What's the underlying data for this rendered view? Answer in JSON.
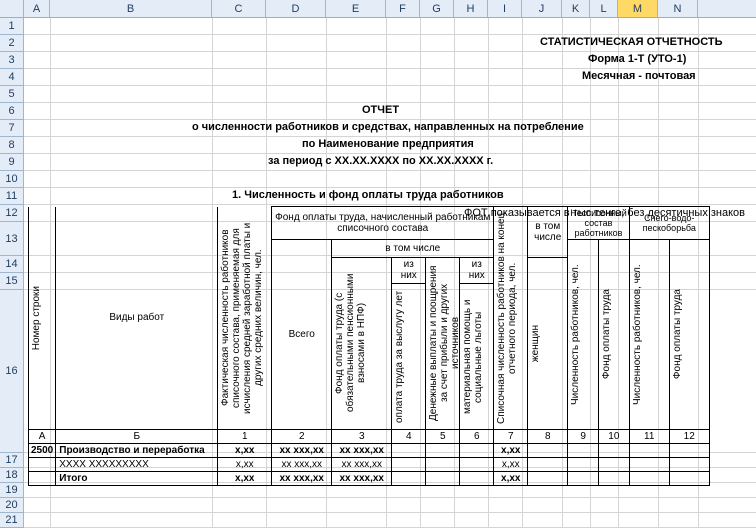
{
  "columns": [
    {
      "label": "A",
      "w": 26
    },
    {
      "label": "B",
      "w": 162
    },
    {
      "label": "C",
      "w": 54
    },
    {
      "label": "D",
      "w": 60
    },
    {
      "label": "E",
      "w": 60
    },
    {
      "label": "F",
      "w": 34
    },
    {
      "label": "G",
      "w": 34
    },
    {
      "label": "H",
      "w": 34
    },
    {
      "label": "I",
      "w": 34
    },
    {
      "label": "J",
      "w": 40
    },
    {
      "label": "K",
      "w": 28
    },
    {
      "label": "L",
      "w": 28
    },
    {
      "label": "M",
      "w": 40
    },
    {
      "label": "N",
      "w": 40
    }
  ],
  "selected_col": "M",
  "row_labels": [
    "1",
    "2",
    "3",
    "4",
    "5",
    "6",
    "7",
    "8",
    "9",
    "10",
    "11",
    "12",
    "13",
    "14",
    "15",
    "16",
    "17",
    "18",
    "19",
    "20",
    "21"
  ],
  "header": {
    "stat": "СТАТИСТИЧЕСКАЯ ОТЧЕТНОСТЬ",
    "form": "Форма 1-Т (УТО-1)",
    "period_type": "Месячная - почтовая",
    "title": "ОТЧЕТ",
    "line1": "о численности работников и средствах, направленных на потребление",
    "line2": "по Наименование предприятия",
    "line3": "за период с XX.XX.XXXX по XX.XX.XXXX г.",
    "section": "1. Численность и фонд оплаты труда работников",
    "footnote": "ФОТ показывается в тыс.тенге, без десятичных знаков"
  },
  "tbl": {
    "h": {
      "row_no": "Номер строки",
      "work_types": "Виды работ",
      "fact_count": "Фактическая численность работников списочного состава, применяемая для исчисления средней заработной платы и других средних величин, чел.",
      "fot_group": "Фонд оплаты труда, начисленный работникам списочного состава",
      "vsego": "Всего",
      "vtomchisle": "в том числе",
      "iznih": "из них",
      "fot_npf": "Фонд оплаты труда (с обязательными пенсионными взносами в НПФ)",
      "vysluga": "оплата труда за выслугу лет",
      "denezh": "Денежные выплаты и поощрения за счет прибыли и других источников",
      "matpom": "материальная помощь и социальные льготы",
      "spis_count": "Списочная численность работников на конец отчетного периода, чел.",
      "vtomchisle2": "в том числе",
      "women": "женщин",
      "nespis": "Несписочный состав работников",
      "snego": "Снего-водо-пескоборьба",
      "chisl": "Численность работников, чел.",
      "fot": "Фонд оплаты труда"
    },
    "numrow": [
      "А",
      "Б",
      "1",
      "2",
      "3",
      "4",
      "5",
      "6",
      "7",
      "8",
      "9",
      "10",
      "11",
      "12"
    ],
    "rows": [
      {
        "n": "2500",
        "name": "Производство и переработка",
        "vals": [
          "x,xx",
          "xx xxx,xx",
          "xx xxx,xx",
          "",
          "",
          "",
          "x,xx",
          "",
          "",
          "",
          "",
          ""
        ]
      },
      {
        "n": "",
        "name": "XXXX XXXXXXXXX",
        "vals": [
          "x,xx",
          "xx xxx,xx",
          "xx xxx,xx",
          "",
          "",
          "",
          "x,xx",
          "",
          "",
          "",
          "",
          ""
        ]
      },
      {
        "n": "",
        "name": "Итого",
        "vals": [
          "x,xx",
          "xx xxx,xx",
          "xx xxx,xx",
          "",
          "",
          "",
          "x,xx",
          "",
          "",
          "",
          "",
          ""
        ]
      }
    ]
  }
}
